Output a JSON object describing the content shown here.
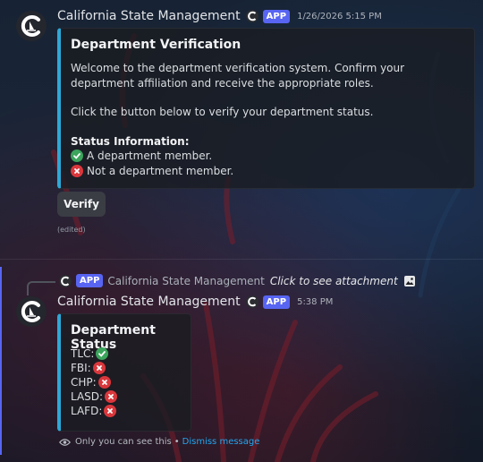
{
  "colors": {
    "brand": "#5865f2",
    "embed_border": "#2ea8d6",
    "success": "#3ba55c",
    "danger": "#da373c",
    "link": "#22a7f0"
  },
  "message1": {
    "username": "California State Management",
    "badge": "APP",
    "timestamp": "1/26/2026 5:15 PM",
    "embed": {
      "title": "Department Verification",
      "description_lines": [
        "Welcome to the department verification system. Confirm your department affiliation and receive the appropriate roles.",
        "Click the button below to verify your department status."
      ],
      "status_heading": "Status Information:",
      "status_items": [
        {
          "icon": "check-icon",
          "text": "A department member."
        },
        {
          "icon": "x-icon",
          "text": "Not a department member."
        }
      ]
    },
    "button_label": "Verify",
    "edited_label": "(edited)"
  },
  "message2": {
    "reply": {
      "badge": "APP",
      "username": "California State Management",
      "attachment_text": "Click to see attachment",
      "icon": "image-icon"
    },
    "username": "California State Management",
    "badge": "APP",
    "timestamp": "5:38 PM",
    "embed": {
      "title": "Department Status",
      "items": [
        {
          "label": "TLC:",
          "status": "check"
        },
        {
          "label": "FBI:",
          "status": "x"
        },
        {
          "label": "CHP:",
          "status": "x"
        },
        {
          "label": "LASD:",
          "status": "x"
        },
        {
          "label": "LAFD:",
          "status": "x"
        }
      ]
    },
    "footer": {
      "visibility_text": "Only you can see this",
      "separator": "•",
      "dismiss_label": "Dismiss message"
    }
  }
}
